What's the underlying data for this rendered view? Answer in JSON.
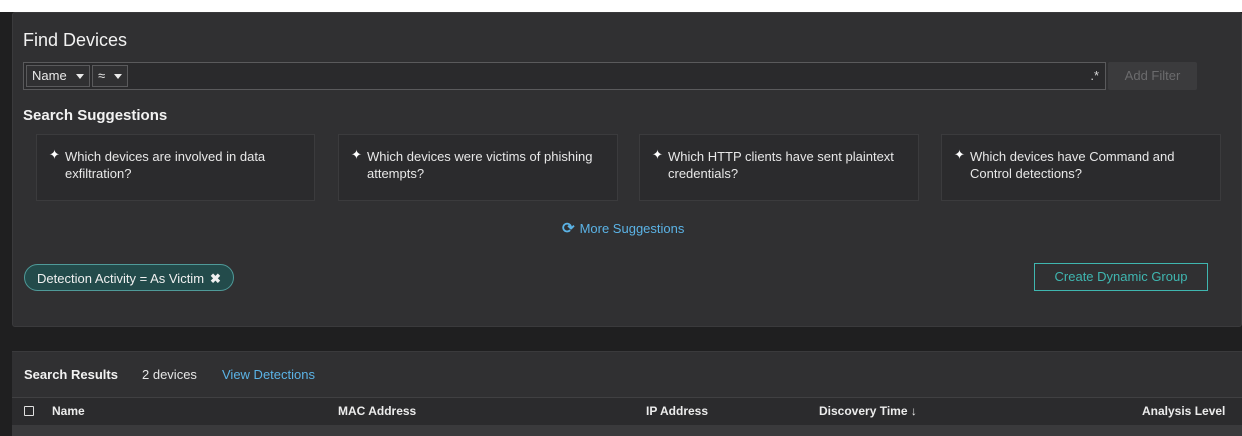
{
  "find_devices": {
    "title": "Find Devices",
    "filter": {
      "field": "Name",
      "operator": "≈",
      "query_value": "",
      "regex_label": ".*",
      "add_filter_label": "Add Filter"
    },
    "suggestions_heading": "Search Suggestions",
    "suggestions": [
      {
        "text": "Which devices are involved in data exfiltration?"
      },
      {
        "text": "Which devices were victims of phishing attempts?"
      },
      {
        "text": "Which HTTP clients have sent plaintext credentials?"
      },
      {
        "text": "Which devices have Command and Control detections?"
      }
    ],
    "more_suggestions_label": "More Suggestions",
    "active_filter_chip": "Detection Activity = As Victim",
    "create_group_label": "Create Dynamic Group"
  },
  "results": {
    "title": "Search Results",
    "count": "2 devices",
    "view_detections_label": "View Detections",
    "columns": [
      "Name",
      "MAC Address",
      "IP Address",
      "Discovery Time ↓",
      "Analysis Level"
    ]
  },
  "colors": {
    "accent_blue": "#5bb3e6",
    "accent_teal": "#3fb6b0",
    "panel_bg": "#303032"
  }
}
